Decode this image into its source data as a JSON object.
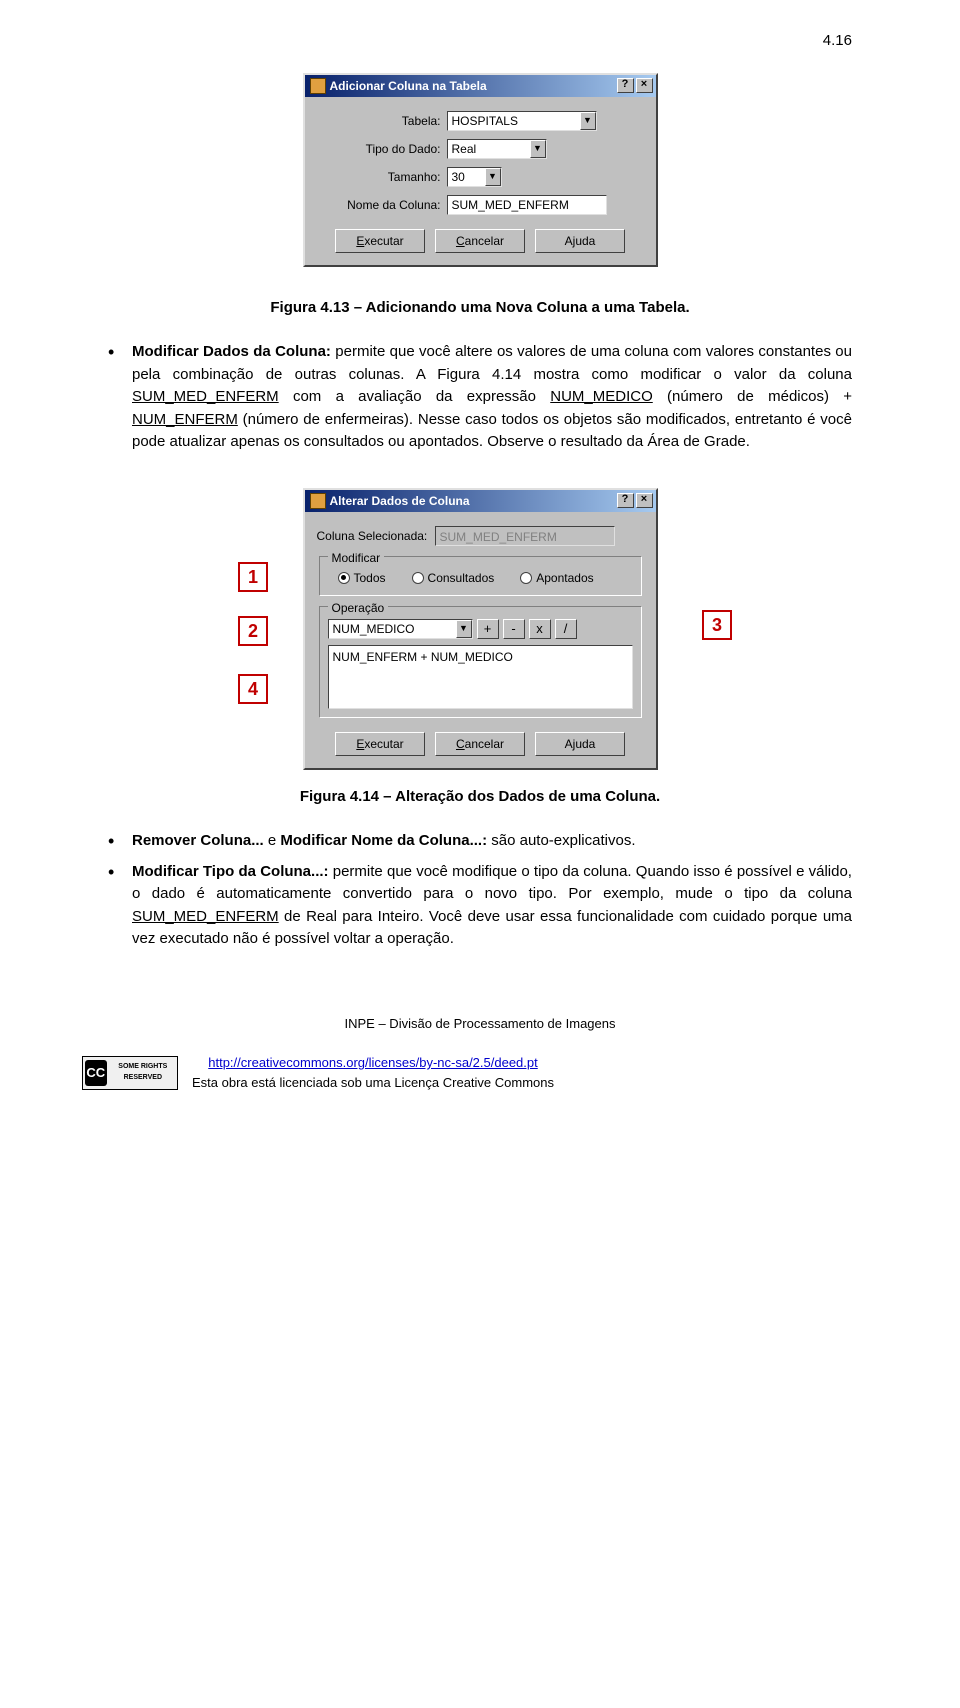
{
  "page_number": "4.16",
  "dialog1": {
    "title": "Adicionar Coluna na Tabela",
    "help_btn": "?",
    "close_btn": "×",
    "labels": {
      "tabela": "Tabela:",
      "tipo": "Tipo do Dado:",
      "tamanho": "Tamanho:",
      "nome": "Nome da Coluna:"
    },
    "values": {
      "tabela": "HOSPITALS",
      "tipo": "Real",
      "tamanho": "30",
      "nome": "SUM_MED_ENFERM"
    },
    "buttons": {
      "executar": "Executar",
      "cancelar": "Cancelar",
      "ajuda": "Ajuda"
    }
  },
  "caption1": "Figura 4.13 – Adicionando uma Nova Coluna a uma Tabela.",
  "para1_a": "Modificar Dados da Coluna:",
  "para1_b": " permite que você altere os valores de uma coluna com valores constantes ou pela combinação de outras colunas. A Figura 4.14 mostra como modificar o valor da coluna ",
  "para1_c": "SUM_MED_ENFERM",
  "para1_d": " com a avaliação da expressão ",
  "para1_e": "NUM_MEDICO",
  "para1_f": " (número de médicos) + ",
  "para1_g": "NUM_ENFERM",
  "para1_h": " (número de enfermeiras). Nesse caso todos os objetos são modificados, entretanto é você pode atualizar apenas os consultados ou apontados. Observe o resultado da Área de Grade.",
  "dialog2": {
    "title": "Alterar Dados de Coluna",
    "coluna_label": "Coluna Selecionada:",
    "coluna_value": "SUM_MED_ENFERM",
    "group_modificar": "Modificar",
    "radios": {
      "todos": "Todos",
      "consultados": "Consultados",
      "apontados": "Apontados"
    },
    "group_operacao": "Operação",
    "op_dd": "NUM_MEDICO",
    "ops": {
      "plus": "+",
      "minus": "-",
      "times": "x",
      "div": "/"
    },
    "expr": "NUM_ENFERM + NUM_MEDICO",
    "buttons": {
      "executar": "Executar",
      "cancelar": "Cancelar",
      "ajuda": "Ajuda"
    }
  },
  "callouts": {
    "c1": "1",
    "c2": "2",
    "c3": "3",
    "c4": "4"
  },
  "caption2": "Figura 4.14 – Alteração dos Dados de uma Coluna.",
  "bullet2_a": "Remover Coluna...",
  "bullet2_b": " e ",
  "bullet2_c": "Modificar Nome da Coluna...:",
  "bullet2_d": " são auto-explicativos.",
  "bullet3_a": "Modificar Tipo da Coluna...:",
  "bullet3_b": " permite que você modifique o tipo da coluna. Quando isso é possível e válido, o dado é automaticamente convertido para o novo tipo. Por exemplo, mude o tipo da coluna ",
  "bullet3_c": "SUM_MED_ENFERM",
  "bullet3_d": " de Real para Inteiro. Você deve usar essa funcionalidade com cuidado porque uma vez executado não é possível voltar a operação.",
  "footer_inpe": "INPE – Divisão de Processamento de Imagens",
  "cc_badge": "SOME RIGHTS RESERVED",
  "cc_url": "http://creativecommons.org/licenses/by-nc-sa/2.5/deed.pt",
  "cc_text": "Esta obra está licenciada sob uma Licença Creative Commons"
}
